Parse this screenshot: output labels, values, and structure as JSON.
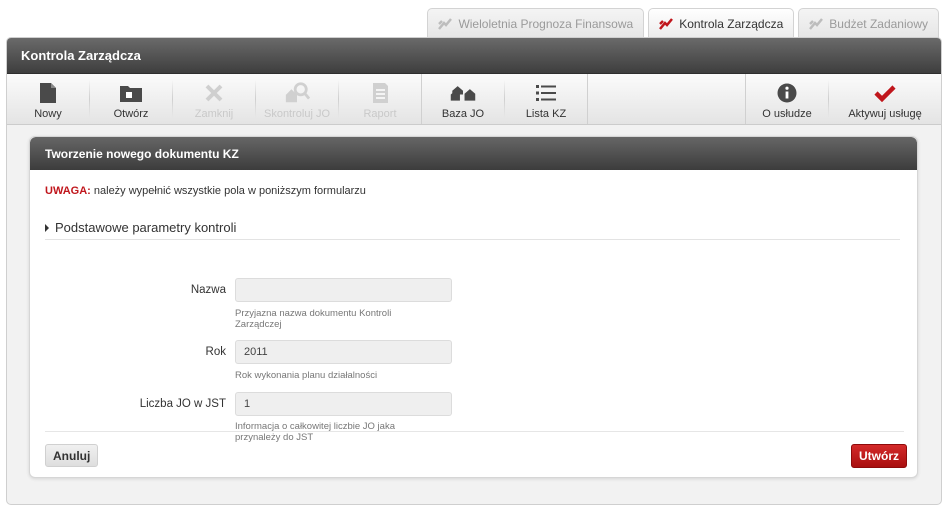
{
  "tabs": [
    {
      "label": "Wieloletnia Prognoza Finansowa",
      "active": false
    },
    {
      "label": "Kontrola Zarządcza",
      "active": true
    },
    {
      "label": "Budżet Zadaniowy",
      "active": false
    }
  ],
  "window": {
    "title": "Kontrola Zarządcza"
  },
  "toolbar": {
    "nowy": "Nowy",
    "otworz": "Otwórz",
    "zamknij": "Zamknij",
    "skontroluj": "Skontroluj JO",
    "raport": "Raport",
    "baza": "Baza JO",
    "lista": "Lista KZ",
    "o_usludze": "O usłudze",
    "aktywuj": "Aktywuj usługę"
  },
  "panel": {
    "title": "Tworzenie nowego dokumentu KZ",
    "warning_label": "UWAGA:",
    "warning_text": " należy wypełnić wszystkie pola w poniższym formularzu",
    "section": "Podstawowe parametry kontroli"
  },
  "form": {
    "nazwa": {
      "label": "Nazwa",
      "value": "",
      "hint": "Przyjazna nazwa dokumentu Kontroli Zarządczej"
    },
    "rok": {
      "label": "Rok",
      "value": "2011",
      "hint": "Rok wykonania planu działalności"
    },
    "liczba": {
      "label": "Liczba JO w JST",
      "value": "1",
      "hint": "Informacja o całkowitej liczbie JO jaka przynależy do JST"
    }
  },
  "buttons": {
    "cancel": "Anuluj",
    "create": "Utwórz"
  },
  "colors": {
    "accent": "#c0161c",
    "header_dark": "#3e3e3e"
  }
}
